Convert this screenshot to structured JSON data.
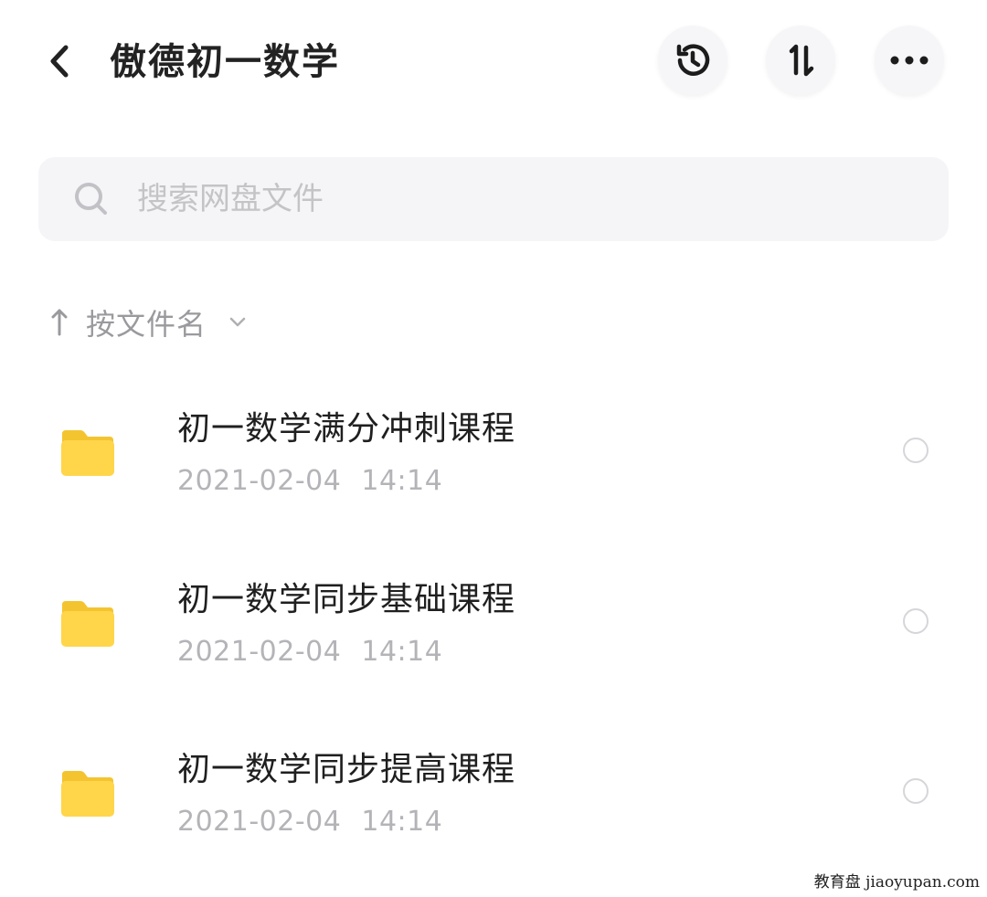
{
  "header": {
    "title": "傲德初一数学",
    "back_icon": "chevron-left-icon",
    "actions": [
      {
        "name": "history",
        "icon": "history-icon"
      },
      {
        "name": "sort",
        "icon": "sort-arrows-icon"
      },
      {
        "name": "more",
        "icon": "more-dots-icon"
      }
    ]
  },
  "search": {
    "placeholder": "搜索网盘文件",
    "value": "",
    "icon": "search-icon"
  },
  "sort_bar": {
    "label": "按文件名",
    "direction_icon": "arrow-up-icon",
    "dropdown_icon": "chevron-down-icon"
  },
  "files": [
    {
      "name": "初一数学满分冲刺课程",
      "date": "2021-02-04",
      "time": "14:14",
      "type": "folder"
    },
    {
      "name": "初一数学同步基础课程",
      "date": "2021-02-04",
      "time": "14:14",
      "type": "folder"
    },
    {
      "name": "初一数学同步提高课程",
      "date": "2021-02-04",
      "time": "14:14",
      "type": "folder"
    }
  ],
  "watermark": "教育盘 jiaoyupan.com",
  "colors": {
    "folder": "#FFD54A",
    "folder_dark": "#F4C430",
    "muted_text": "#B4B4B8",
    "search_bg": "#F5F5F7"
  }
}
